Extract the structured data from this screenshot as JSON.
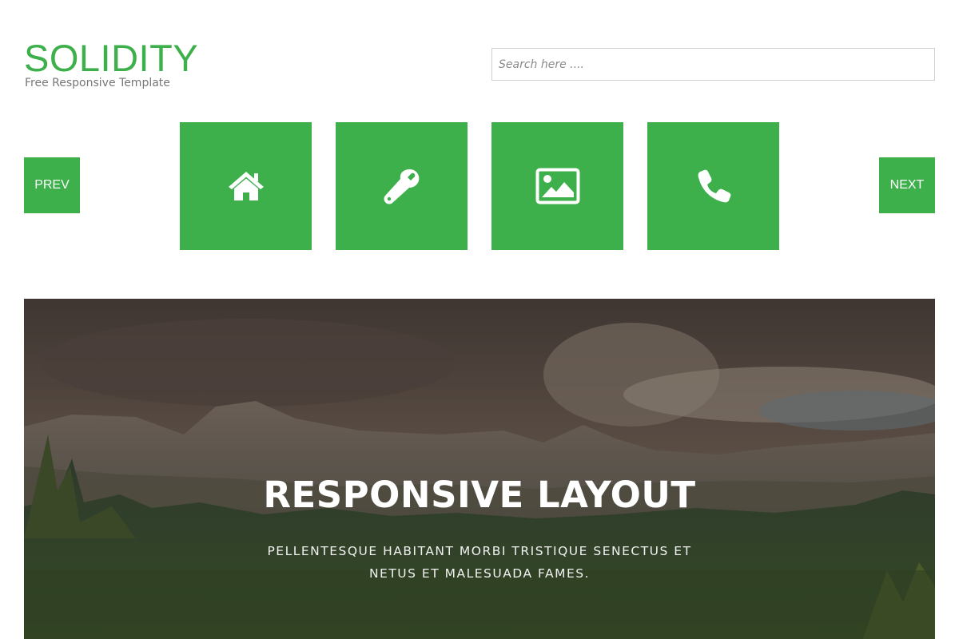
{
  "header": {
    "logo_title": "SOLIDITY",
    "logo_subtitle": "Free Responsive Template",
    "search_placeholder": "Search here ...."
  },
  "nav": {
    "prev_label": "PREV",
    "next_label": "NEXT"
  },
  "tiles": [
    {
      "icon": "home-icon"
    },
    {
      "icon": "wrench-icon"
    },
    {
      "icon": "picture-icon"
    },
    {
      "icon": "phone-icon"
    }
  ],
  "hero": {
    "title": "RESPONSIVE LAYOUT",
    "text": "PELLENTESQUE HABITANT MORBI TRISTIQUE SENECTUS ET NETUS ET MALESUADA FAMES."
  },
  "colors": {
    "accent": "#3db04b",
    "white": "#ffffff"
  }
}
